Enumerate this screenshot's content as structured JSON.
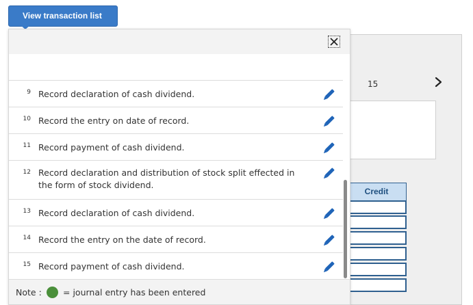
{
  "top_button": {
    "label": "View transaction list"
  },
  "background": {
    "page_number": "15",
    "credit_header": "Credit",
    "next_icon": "chevron-right-icon"
  },
  "popup": {
    "close_icon": "close-icon",
    "rows": [
      {
        "num": "9",
        "text": "Record declaration of cash dividend."
      },
      {
        "num": "10",
        "text": "Record the entry on date of record."
      },
      {
        "num": "11",
        "text": "Record payment of cash dividend."
      },
      {
        "num": "12",
        "text": "Record declaration and distribution of stock split effected in the form of stock dividend."
      },
      {
        "num": "13",
        "text": "Record declaration of cash dividend."
      },
      {
        "num": "14",
        "text": "Record the entry on the date of record."
      },
      {
        "num": "15",
        "text": "Record payment of cash dividend."
      }
    ],
    "edit_icon": "pencil-icon",
    "note": {
      "label": "Note :",
      "text": "= journal entry has been entered",
      "dot_color": "#4a8f3a"
    }
  },
  "colors": {
    "accent": "#3a7bc8",
    "edit_icon": "#1f64b8",
    "table_border": "#2e5f8f"
  }
}
